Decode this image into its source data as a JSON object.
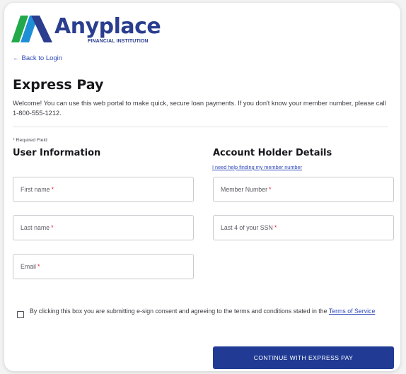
{
  "brand": {
    "name": "Anyplace",
    "subtitle": "FINANCIAL INSTITUTION",
    "colors": {
      "navy": "#2a3d8f",
      "green": "#22a94a",
      "blue": "#2f49b8"
    }
  },
  "nav": {
    "back_label": "Back to Login",
    "back_icon": "arrow-left-icon"
  },
  "page": {
    "title": "Express Pay",
    "intro": "Welcome! You can use this web portal to make quick, secure loan payments. If you don't know your member number, please call 1-800-555-1212.",
    "required_note": "* Required Field"
  },
  "user_info": {
    "title": "User Information",
    "fields": {
      "first_name": {
        "label": "First name",
        "required": "*"
      },
      "last_name": {
        "label": "Last name",
        "required": "*"
      },
      "email": {
        "label": "Email",
        "required": "*"
      }
    }
  },
  "account": {
    "title": "Account Holder Details",
    "help_link": "I need help finding my member number",
    "fields": {
      "member_number": {
        "label": "Member Number",
        "required": "*"
      },
      "ssn_last4": {
        "label": "Last 4 of your SSN",
        "required": "*"
      }
    }
  },
  "consent": {
    "text": "By clicking this box you are submitting e-sign consent and agreeing to the terms and conditions stated in the",
    "link": "Terms of Service",
    "checked": false
  },
  "submit": {
    "label": "CONTINUE WITH EXPRESS PAY",
    "color": "#213b95"
  }
}
